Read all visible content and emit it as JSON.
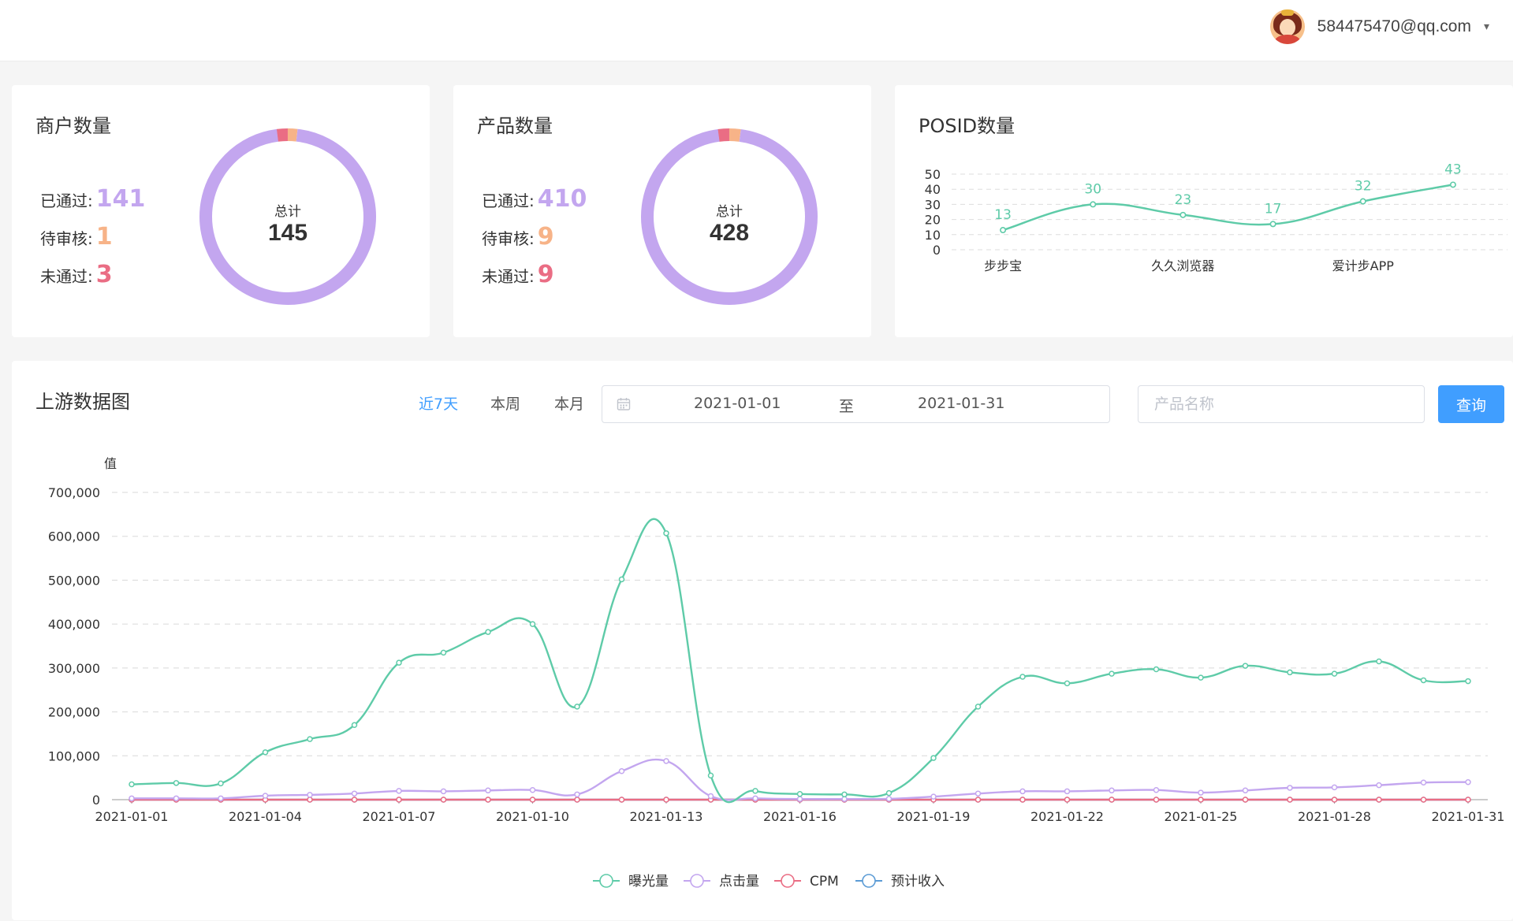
{
  "header": {
    "user_email": "584475470@qq.com",
    "user_menu_icon": "chevron-down-icon"
  },
  "merchant": {
    "title": "商户数量",
    "passed_label": "已通过:",
    "passed": "141",
    "pending_label": "待审核:",
    "pending": "1",
    "failed_label": "未通过:",
    "failed": "3",
    "total_label": "总计",
    "total": "145"
  },
  "product": {
    "title": "产品数量",
    "passed_label": "已通过:",
    "passed": "410",
    "pending_label": "待审核:",
    "pending": "9",
    "failed_label": "未通过:",
    "failed": "9",
    "total_label": "总计",
    "total": "428"
  },
  "posid": {
    "title": "POSID数量"
  },
  "upstream": {
    "title": "上游数据图",
    "range_buttons": [
      "近7天",
      "本周",
      "本月"
    ],
    "active_range": "近7天",
    "date_start": "2021-01-01",
    "date_separator": "至",
    "date_end": "2021-01-31",
    "product_placeholder": "产品名称",
    "query_label": "查询"
  },
  "colors": {
    "passed": "#c3a6ef",
    "pending": "#f7b388",
    "failed": "#ea6d84",
    "exposure": "#5ecba8",
    "clicks": "#c3a6ef",
    "cpm": "#ea6d84",
    "revenue": "#5b9bd5",
    "primary": "#409eff"
  },
  "chart_data": [
    {
      "type": "pie",
      "variant": "donut",
      "labels": [
        "已通过",
        "待审核",
        "未通过"
      ],
      "values": [
        141,
        1,
        3
      ]
    },
    {
      "type": "pie",
      "variant": "donut",
      "labels": [
        "已通过",
        "待审核",
        "未通过"
      ],
      "values": [
        410,
        9,
        9
      ]
    },
    {
      "type": "line",
      "smooth": true,
      "title": "",
      "ylabel": "POSID数量",
      "ylim": [
        0,
        50
      ],
      "yticks": [
        0,
        10,
        20,
        30,
        40,
        50
      ],
      "categories": [
        "步步宝",
        "",
        "久久浏览器",
        "",
        "爱计步APP",
        ""
      ],
      "series": [
        {
          "values": [
            13,
            30,
            23,
            17,
            32,
            43
          ]
        }
      ],
      "data_labels": true,
      "grid": true
    },
    {
      "type": "line",
      "smooth": true,
      "ylabel": "值",
      "ylim": [
        0,
        700000
      ],
      "yticks": [
        0,
        100000,
        200000,
        300000,
        400000,
        500000,
        600000,
        700000
      ],
      "ytick_labels": [
        "0",
        "100,000",
        "200,000",
        "300,000",
        "400,000",
        "500,000",
        "600,000",
        "700,000"
      ],
      "x": [
        "2021-01-01",
        "2021-01-02",
        "2021-01-03",
        "2021-01-04",
        "2021-01-05",
        "2021-01-06",
        "2021-01-07",
        "2021-01-08",
        "2021-01-09",
        "2021-01-10",
        "2021-01-11",
        "2021-01-12",
        "2021-01-13",
        "2021-01-14",
        "2021-01-15",
        "2021-01-16",
        "2021-01-17",
        "2021-01-18",
        "2021-01-19",
        "2021-01-20",
        "2021-01-21",
        "2021-01-22",
        "2021-01-23",
        "2021-01-24",
        "2021-01-25",
        "2021-01-26",
        "2021-01-27",
        "2021-01-28",
        "2021-01-29",
        "2021-01-30",
        "2021-01-31"
      ],
      "xtick_labels": [
        "2021-01-01",
        "2021-01-04",
        "2021-01-07",
        "2021-01-10",
        "2021-01-13",
        "2021-01-16",
        "2021-01-19",
        "2021-01-22",
        "2021-01-25",
        "2021-01-28",
        "2021-01-31"
      ],
      "series": [
        {
          "name": "曝光量",
          "values": [
            35000,
            38000,
            37000,
            108000,
            138000,
            170000,
            312000,
            335000,
            382000,
            400000,
            212000,
            502000,
            607000,
            55000,
            20000,
            13000,
            12000,
            15000,
            95000,
            212000,
            280000,
            265000,
            287000,
            297000,
            278000,
            305000,
            290000,
            287000,
            315000,
            272000,
            270000
          ]
        },
        {
          "name": "点击量",
          "values": [
            3000,
            3000,
            3000,
            9000,
            11000,
            14000,
            20000,
            19000,
            21000,
            22000,
            12000,
            65000,
            88000,
            8000,
            3000,
            1500,
            1500,
            2000,
            7000,
            14000,
            19000,
            19000,
            21000,
            22000,
            16000,
            21000,
            27000,
            28000,
            33000,
            39000,
            40000
          ]
        },
        {
          "name": "CPM",
          "values": [
            2,
            2,
            2,
            2,
            2,
            2,
            2,
            2,
            2,
            2,
            2,
            2,
            2,
            2,
            2,
            2,
            2,
            2,
            2,
            2,
            2,
            2,
            2,
            2,
            2,
            2,
            2,
            2,
            2,
            2,
            2
          ]
        },
        {
          "name": "预计收入",
          "values": [
            0,
            0,
            0,
            0,
            0,
            0,
            0,
            0,
            0,
            0,
            0,
            0,
            0,
            0,
            0,
            0,
            0,
            0,
            0,
            0,
            0,
            0,
            0,
            0,
            0,
            0,
            0,
            0,
            0,
            0,
            0
          ]
        }
      ],
      "legend_position": "bottom-center",
      "grid": true
    }
  ]
}
